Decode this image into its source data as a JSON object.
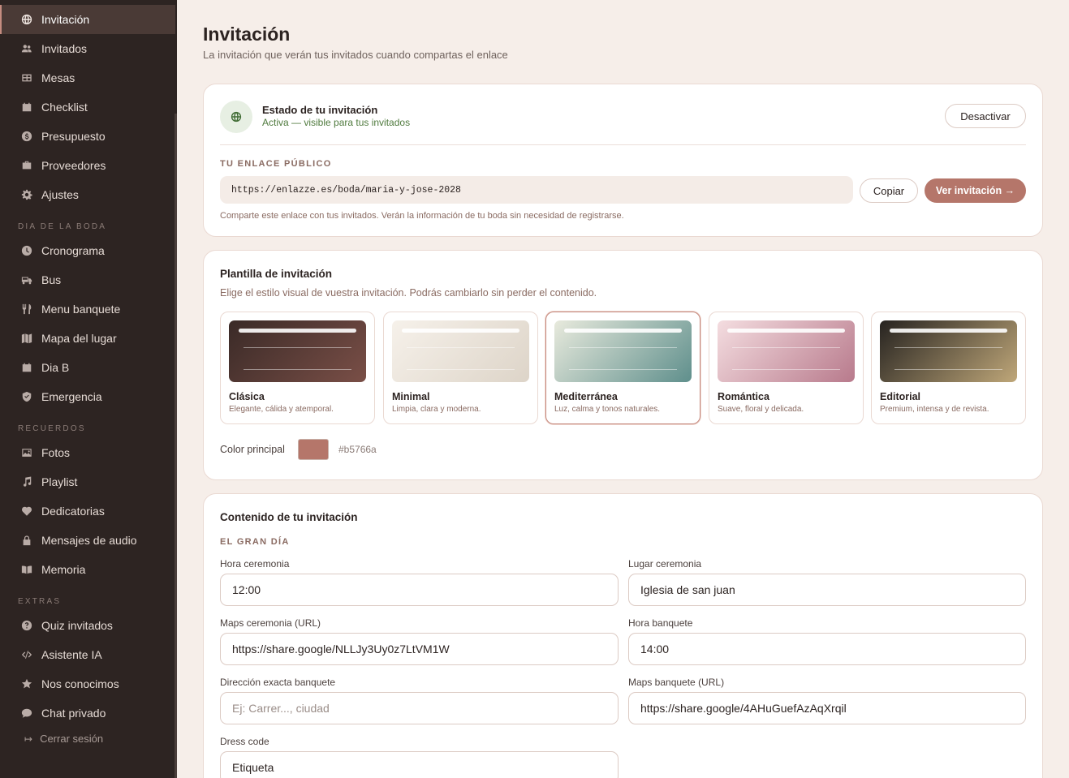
{
  "sidebar": {
    "items": [
      {
        "label": "Invitación",
        "icon": "globe-icon",
        "active": true
      },
      {
        "label": "Invitados",
        "icon": "users-icon"
      },
      {
        "label": "Mesas",
        "icon": "table-icon"
      },
      {
        "label": "Checklist",
        "icon": "calendar-icon"
      },
      {
        "label": "Presupuesto",
        "icon": "dollar-icon"
      },
      {
        "label": "Proveedores",
        "icon": "briefcase-icon"
      },
      {
        "label": "Ajustes",
        "icon": "gear-icon"
      }
    ],
    "section_day": "DIA DE LA BODA",
    "day_items": [
      {
        "label": "Cronograma",
        "icon": "clock-icon"
      },
      {
        "label": "Bus",
        "icon": "bus-icon"
      },
      {
        "label": "Menu banquete",
        "icon": "cutlery-icon"
      },
      {
        "label": "Mapa del lugar",
        "icon": "map-icon"
      },
      {
        "label": "Dia B",
        "icon": "calendar-icon"
      },
      {
        "label": "Emergencia",
        "icon": "shield-icon"
      }
    ],
    "section_memories": "RECUERDOS",
    "memory_items": [
      {
        "label": "Fotos",
        "icon": "image-icon"
      },
      {
        "label": "Playlist",
        "icon": "music-icon"
      },
      {
        "label": "Dedicatorias",
        "icon": "heart-icon"
      },
      {
        "label": "Mensajes de audio",
        "icon": "lock-icon"
      },
      {
        "label": "Memoria",
        "icon": "book-icon"
      }
    ],
    "section_extras": "EXTRAS",
    "extra_items": [
      {
        "label": "Quiz invitados",
        "icon": "question-icon"
      },
      {
        "label": "Asistente IA",
        "icon": "code-icon"
      },
      {
        "label": "Nos conocimos",
        "icon": "star-icon"
      },
      {
        "label": "Chat privado",
        "icon": "chat-icon"
      }
    ],
    "logout": "Cerrar sesión"
  },
  "header": {
    "title": "Invitación",
    "subtitle": "La invitación que verán tus invitados cuando compartas el enlace"
  },
  "status_card": {
    "title": "Estado de tu invitación",
    "status": "Activa — visible para tus invitados",
    "deactivate": "Desactivar",
    "link_label": "TU ENLACE PÚBLICO",
    "url": "https://enlazze.es/boda/maria-y-jose-2028",
    "copy": "Copiar",
    "view": "Ver invitación →",
    "hint": "Comparte este enlace con tus invitados. Verán la información de tu boda sin necesidad de registrarse."
  },
  "template_card": {
    "title": "Plantilla de invitación",
    "description": "Elige el estilo visual de vuestra invitación. Podrás cambiarlo sin perder el contenido.",
    "templates": [
      {
        "name": "Clásica",
        "desc": "Elegante, cálida y atemporal.",
        "colors": [
          "#3a2a27",
          "#7a4f47"
        ]
      },
      {
        "name": "Minimal",
        "desc": "Limpia, clara y moderna.",
        "colors": [
          "#f6f1ea",
          "#ddd4c8"
        ]
      },
      {
        "name": "Mediterránea",
        "desc": "Luz, calma y tonos naturales.",
        "colors": [
          "#e8eadd",
          "#5f8f8c"
        ],
        "selected": true
      },
      {
        "name": "Romántica",
        "desc": "Suave, floral y delicada.",
        "colors": [
          "#f4dde0",
          "#b87a8c"
        ]
      },
      {
        "name": "Editorial",
        "desc": "Premium, intensa y de revista.",
        "colors": [
          "#262320",
          "#bfa779"
        ]
      }
    ],
    "color_label": "Color principal",
    "color_value": "#b5766a"
  },
  "content_card": {
    "title": "Contenido de tu invitación",
    "section": "EL GRAN DÍA",
    "fields": {
      "hora_ceremonia": {
        "label": "Hora ceremonia",
        "value": "12:00"
      },
      "lugar_ceremonia": {
        "label": "Lugar ceremonia",
        "value": "Iglesia de san juan"
      },
      "maps_ceremonia": {
        "label": "Maps ceremonia (URL)",
        "value": "https://share.google/NLLJy3Uy0z7LtVM1W"
      },
      "hora_banquete": {
        "label": "Hora banquete",
        "value": "14:00"
      },
      "direccion_banquete": {
        "label": "Dirección exacta banquete",
        "value": "",
        "placeholder": "Ej: Carrer..., ciudad"
      },
      "maps_banquete": {
        "label": "Maps banquete (URL)",
        "value": "https://share.google/4AHuGuefAzAqXrqil"
      },
      "dress_code": {
        "label": "Dress code",
        "value": "Etiqueta"
      }
    }
  }
}
